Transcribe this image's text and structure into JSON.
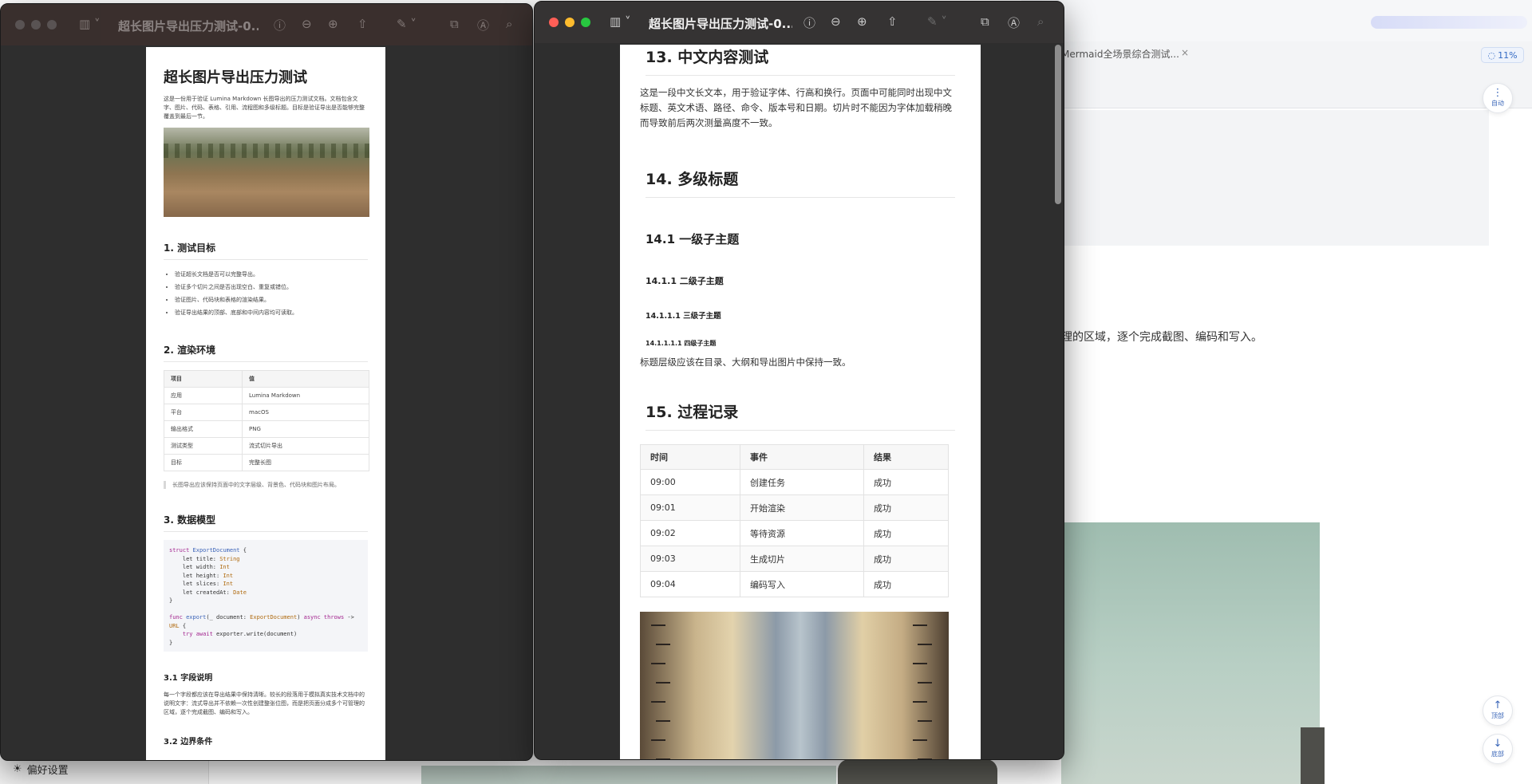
{
  "background_app": {
    "tab": {
      "title": "Mermaid全场景综合测试...",
      "close": "×"
    },
    "progress": "11%",
    "paragraph_fragment": "理的区域，逐个完成截图、编码和写入。",
    "buttons": {
      "auto": "自动",
      "top": "顶部",
      "bottom": "底部"
    },
    "preferences": "偏好设置"
  },
  "windows": {
    "left": {
      "title": "超长图片导出压力测试-0..."
    },
    "right": {
      "title": "超长图片导出压力测试-0..."
    }
  },
  "doc_left": {
    "title": "超长图片导出压力测试",
    "intro": "这是一份用于验证 Lumina Markdown 长图导出的压力测试文档。文档包含文字、图片、代码、表格、引用、流程图和多级标题。目标是验证导出是否能够完整覆盖到最后一节。",
    "s1": {
      "heading": "1. 测试目标",
      "items": [
        "验证超长文档是否可以完整导出。",
        "验证多个切片之间是否出现空白、重复或错位。",
        "验证图片、代码块和表格的渲染结果。",
        "验证导出结果的顶部、底部和中间内容均可读取。"
      ]
    },
    "s2": {
      "heading": "2. 渲染环境",
      "table": {
        "headers": [
          "项目",
          "值"
        ],
        "rows": [
          [
            "应用",
            "Lumina Markdown"
          ],
          [
            "平台",
            "macOS"
          ],
          [
            "输出格式",
            "PNG"
          ],
          [
            "测试类型",
            "流式切片导出"
          ],
          [
            "目标",
            "完整长图"
          ]
        ]
      },
      "quote": "长图导出应该保持页面中的文字层级、背景色、代码块和图片布局。"
    },
    "s3": {
      "heading": "3. 数据模型",
      "code": {
        "struct_kw": "struct",
        "struct_name": "ExportDocument",
        "brace_open": " {",
        "fields": [
          {
            "name": "    let title: ",
            "type": "String"
          },
          {
            "name": "    let width: ",
            "type": "Int"
          },
          {
            "name": "    let height: ",
            "type": "Int"
          },
          {
            "name": "    let slices: ",
            "type": "Int"
          },
          {
            "name": "    let createdAt: ",
            "type": "Date"
          }
        ],
        "brace_close": "}",
        "func_kw": "func",
        "func_name": "export",
        "func_args": "(_ document: ",
        "func_type": "ExportDocument",
        "func_tail": ") ",
        "async_kw": "async throws",
        "arrow": " ->",
        "ret_type": "URL",
        "ret_brace": " {",
        "try_kw": "    try await",
        "call": " exporter.write(document)",
        "end": "}"
      },
      "sub1": {
        "heading": "3.1 字段说明",
        "text": "每一个字段都应该在导出结果中保持清晰。较长的段落用于模拟真实技术文档中的说明文字：流式导出并不依赖一次性创建整张位图，而是把页面分成多个可管理的区域，逐个完成截图、编码和写入。"
      },
      "sub2": {
        "heading": "3.2 边界条件"
      }
    }
  },
  "doc_right": {
    "s13": {
      "heading": "13. 中文内容测试",
      "text": "这是一段中文长文本，用于验证字体、行高和换行。页面中可能同时出现中文标题、英文术语、路径、命令、版本号和日期。切片时不能因为字体加载稍晚而导致前后两次测量高度不一致。"
    },
    "s14": {
      "heading": "14. 多级标题",
      "h3": "14.1 一级子主题",
      "h4": "14.1.1 二级子主题",
      "h5": "14.1.1.1 三级子主题",
      "h6": "14.1.1.1.1 四级子主题",
      "text": "标题层级应该在目录、大纲和导出图片中保持一致。"
    },
    "s15": {
      "heading": "15. 过程记录",
      "table": {
        "headers": [
          "时间",
          "事件",
          "结果"
        ],
        "rows": [
          [
            "09:00",
            "创建任务",
            "成功"
          ],
          [
            "09:01",
            "开始渲染",
            "成功"
          ],
          [
            "09:02",
            "等待资源",
            "成功"
          ],
          [
            "09:03",
            "生成切片",
            "成功"
          ],
          [
            "09:04",
            "编码写入",
            "成功"
          ]
        ]
      }
    }
  },
  "icons": [
    "sidebar-icon",
    "info-icon",
    "zoom-out-icon",
    "zoom-in-icon",
    "share-icon",
    "markup-pen-icon",
    "rotate-icon",
    "annotate-icon",
    "search-icon",
    "arrow-up-icon",
    "arrow-down-icon",
    "gear-icon"
  ],
  "colors": {
    "close": "#ff5f57",
    "minimize": "#febc2e",
    "zoom": "#28c840",
    "accent": "#3a66b8"
  }
}
